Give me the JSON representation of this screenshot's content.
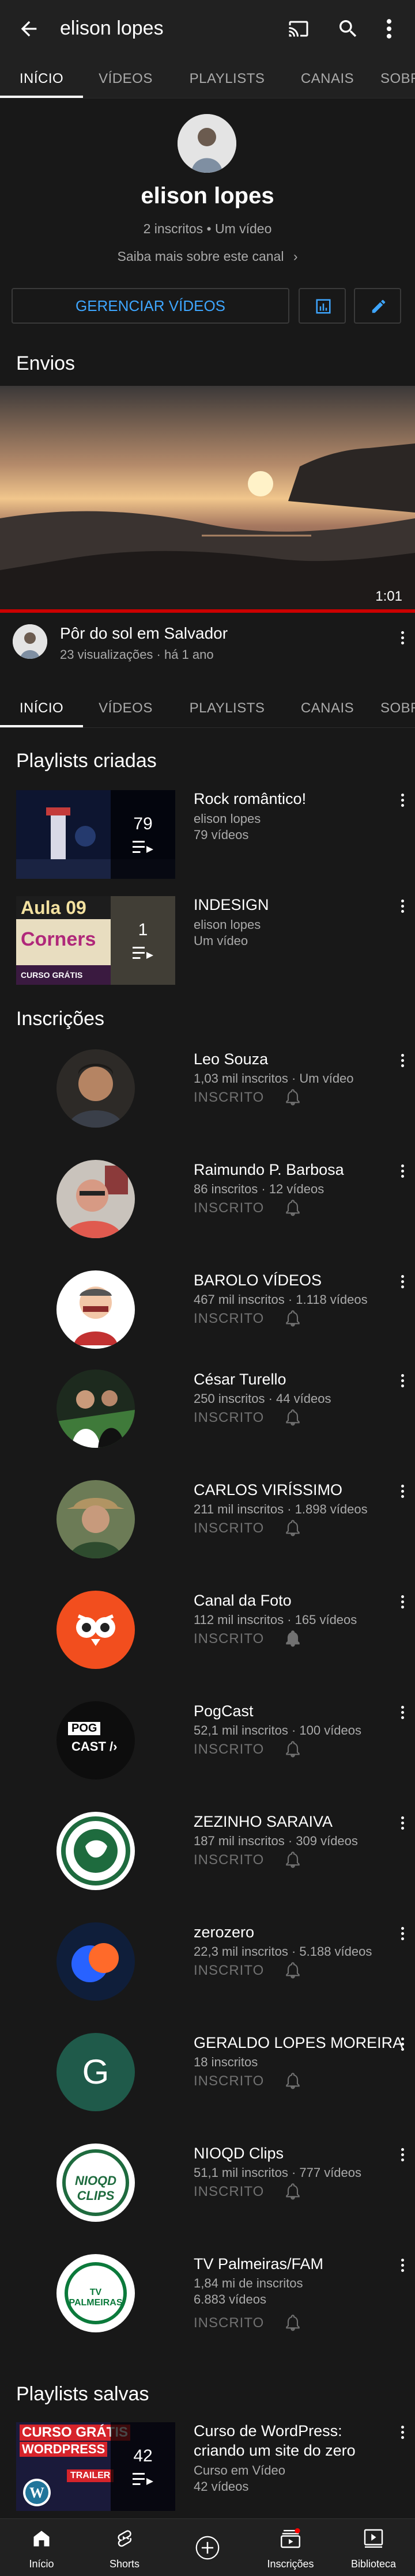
{
  "header": {
    "title": "elison lopes",
    "back_icon": "arrow-back-icon",
    "cast_icon": "cast-icon",
    "search_icon": "search-icon",
    "more_icon": "more-vert-icon"
  },
  "tabs": [
    {
      "label": "INÍCIO",
      "active": true
    },
    {
      "label": "VÍDEOS"
    },
    {
      "label": "PLAYLISTS"
    },
    {
      "label": "CANAIS"
    },
    {
      "label": "SOBRE"
    }
  ],
  "channel": {
    "name": "elison lopes",
    "stats": "2 inscritos • Um vídeo",
    "about": "Saiba mais sobre este canal",
    "manage_label": "GERENCIAR VÍDEOS"
  },
  "uploads": {
    "title": "Envios",
    "video": {
      "duration": "1:01",
      "title": "Pôr do sol em Salvador",
      "meta": "23 visualizações · há 1 ano"
    }
  },
  "playlists_created": {
    "title": "Playlists criadas",
    "items": [
      {
        "title": "Rock romântico!",
        "channel": "elison lopes",
        "count_text": "79 vídeos",
        "count": "79"
      },
      {
        "title": "INDESIGN",
        "channel": "elison lopes",
        "count_text": "Um vídeo",
        "count": "1",
        "thumb_text1": "Aula 09",
        "thumb_text2": "Corners",
        "thumb_text3": "CURSO GRÁTIS"
      }
    ]
  },
  "subscriptions": {
    "title": "Inscrições",
    "button_label": "INSCRITO",
    "items": [
      {
        "name": "Leo Souza",
        "meta": "1,03 mil inscritos · Um vídeo"
      },
      {
        "name": "Raimundo P. Barbosa",
        "meta": "86 inscritos · 12 vídeos"
      },
      {
        "name": "BAROLO VÍDEOS",
        "meta": "467 mil inscritos · 1.118 vídeos"
      },
      {
        "name": "César Turello",
        "meta": "250 inscritos · 44 vídeos"
      },
      {
        "name": "CARLOS VIRÍSSIMO",
        "meta": "211 mil inscritos · 1.898 vídeos"
      },
      {
        "name": "Canal da Foto",
        "meta": "112 mil inscritos · 165 vídeos"
      },
      {
        "name": "PogCast",
        "meta": "52,1 mil inscritos · 100 vídeos",
        "logo_text1": "POG",
        "logo_text2": "CAST /›"
      },
      {
        "name": "ZEZINHO SARAIVA",
        "meta": "187 mil inscritos · 309 vídeos"
      },
      {
        "name": "zerozero",
        "meta": "22,3 mil inscritos · 5.188 vídeos"
      },
      {
        "name": "GERALDO LOPES MOREIRA",
        "meta": "18 inscritos",
        "initial": "G"
      },
      {
        "name": "NIOQD Clips",
        "meta": "51,1 mil inscritos · 777 vídeos",
        "logo_text": "NIOQD CLIPS"
      },
      {
        "name": "TV Palmeiras/FAM",
        "meta": "1,84 mi de inscritos",
        "meta2": "6.883 vídeos",
        "logo_text": "TV PALMEIRAS"
      }
    ]
  },
  "playlists_saved": {
    "title": "Playlists salvas",
    "items": [
      {
        "title": "Curso de WordPress:",
        "title2": "criando um site do zero",
        "channel": "Curso em Vídeo",
        "count_text": "42 vídeos",
        "count": "42",
        "thumb_text1": "CURSO GRÁTIS",
        "thumb_text2": "WORDPRESS",
        "thumb_text3": "TRAILER"
      }
    ]
  },
  "bottom_nav": [
    {
      "label": "Início",
      "icon": "home-icon"
    },
    {
      "label": "Shorts",
      "icon": "shorts-icon"
    },
    {
      "label": "",
      "icon": "create-icon"
    },
    {
      "label": "Inscrições",
      "icon": "subscriptions-icon"
    },
    {
      "label": "Biblioteca",
      "icon": "library-icon"
    }
  ],
  "colors": {
    "accent": "#3ea6ff",
    "progress": "#cc0000",
    "background": "#181818",
    "bar": "#212121"
  }
}
